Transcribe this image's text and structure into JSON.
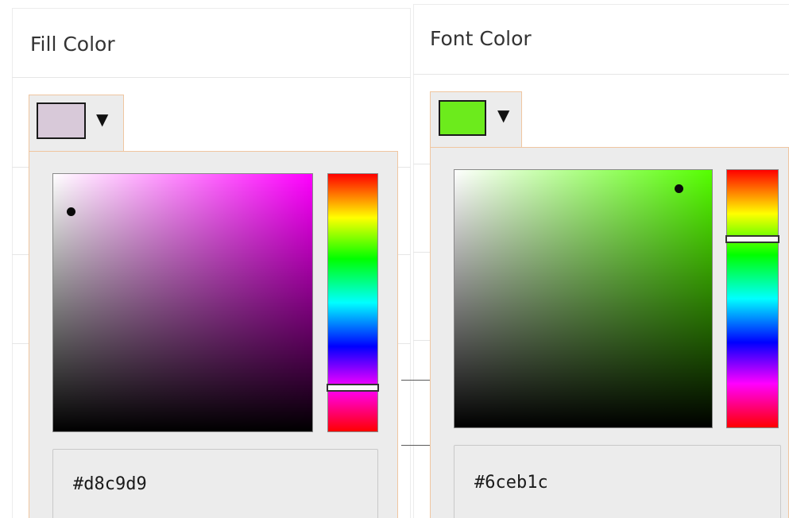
{
  "fill": {
    "title": "Fill Color",
    "swatch_color": "#d8c9d9",
    "dropdown_arrow": "▼",
    "hue_color": "#ff00ff",
    "hue_fraction": 0.83,
    "hex_value": "#d8c9d9"
  },
  "font": {
    "title": "Font Color",
    "swatch_color": "#6ceb1c",
    "dropdown_arrow": "▼",
    "hue_color": "#55ff00",
    "hue_fraction": 0.27,
    "hex_value": "#6ceb1c"
  },
  "colors": {
    "popup_border": "#f0c6a0",
    "popup_background": "#ececec"
  }
}
